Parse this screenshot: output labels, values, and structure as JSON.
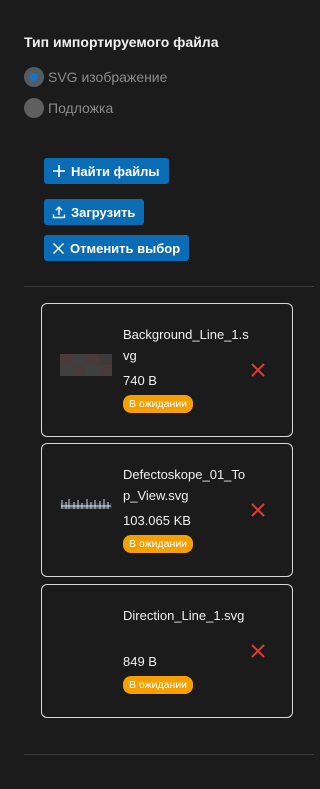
{
  "section_title": "Тип импортируемого файла",
  "import_type": {
    "options": [
      {
        "label": "SVG изображение",
        "checked": true
      },
      {
        "label": "Подложка",
        "checked": false
      }
    ]
  },
  "buttons": {
    "find_files": "Найти файлы",
    "upload": "Загрузить",
    "cancel_selection": "Отменить выбор"
  },
  "files": [
    {
      "name": "Background_Line_1.svg",
      "size": "740 B",
      "status": "В ожидании",
      "thumbnail": "dark-blocks"
    },
    {
      "name": "Defectoskope_01_Top_View.svg",
      "size": "103.065 KB",
      "status": "В ожидании",
      "thumbnail": "schematic-strip"
    },
    {
      "name": "Direction_Line_1.svg",
      "size": "849 B",
      "status": "В ожидании",
      "thumbnail": "none"
    }
  ],
  "colors": {
    "accent": "#0b6cb6",
    "status_pending": "#f59f00",
    "remove": "#e53935",
    "background": "#1b1b1b"
  },
  "icons": {
    "find_files": "plus-icon",
    "upload": "upload-icon",
    "cancel_selection": "close-icon",
    "remove_file": "remove-icon"
  }
}
